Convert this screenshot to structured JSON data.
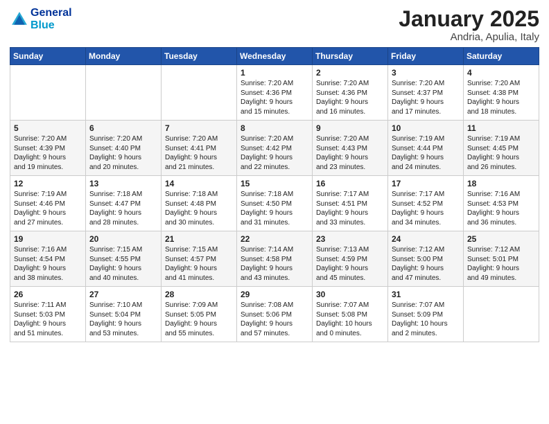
{
  "logo": {
    "line1": "General",
    "line2": "Blue"
  },
  "title": "January 2025",
  "subtitle": "Andria, Apulia, Italy",
  "weekdays": [
    "Sunday",
    "Monday",
    "Tuesday",
    "Wednesday",
    "Thursday",
    "Friday",
    "Saturday"
  ],
  "weeks": [
    [
      {
        "day": "",
        "info": ""
      },
      {
        "day": "",
        "info": ""
      },
      {
        "day": "",
        "info": ""
      },
      {
        "day": "1",
        "info": "Sunrise: 7:20 AM\nSunset: 4:36 PM\nDaylight: 9 hours\nand 15 minutes."
      },
      {
        "day": "2",
        "info": "Sunrise: 7:20 AM\nSunset: 4:36 PM\nDaylight: 9 hours\nand 16 minutes."
      },
      {
        "day": "3",
        "info": "Sunrise: 7:20 AM\nSunset: 4:37 PM\nDaylight: 9 hours\nand 17 minutes."
      },
      {
        "day": "4",
        "info": "Sunrise: 7:20 AM\nSunset: 4:38 PM\nDaylight: 9 hours\nand 18 minutes."
      }
    ],
    [
      {
        "day": "5",
        "info": "Sunrise: 7:20 AM\nSunset: 4:39 PM\nDaylight: 9 hours\nand 19 minutes."
      },
      {
        "day": "6",
        "info": "Sunrise: 7:20 AM\nSunset: 4:40 PM\nDaylight: 9 hours\nand 20 minutes."
      },
      {
        "day": "7",
        "info": "Sunrise: 7:20 AM\nSunset: 4:41 PM\nDaylight: 9 hours\nand 21 minutes."
      },
      {
        "day": "8",
        "info": "Sunrise: 7:20 AM\nSunset: 4:42 PM\nDaylight: 9 hours\nand 22 minutes."
      },
      {
        "day": "9",
        "info": "Sunrise: 7:20 AM\nSunset: 4:43 PM\nDaylight: 9 hours\nand 23 minutes."
      },
      {
        "day": "10",
        "info": "Sunrise: 7:19 AM\nSunset: 4:44 PM\nDaylight: 9 hours\nand 24 minutes."
      },
      {
        "day": "11",
        "info": "Sunrise: 7:19 AM\nSunset: 4:45 PM\nDaylight: 9 hours\nand 26 minutes."
      }
    ],
    [
      {
        "day": "12",
        "info": "Sunrise: 7:19 AM\nSunset: 4:46 PM\nDaylight: 9 hours\nand 27 minutes."
      },
      {
        "day": "13",
        "info": "Sunrise: 7:18 AM\nSunset: 4:47 PM\nDaylight: 9 hours\nand 28 minutes."
      },
      {
        "day": "14",
        "info": "Sunrise: 7:18 AM\nSunset: 4:48 PM\nDaylight: 9 hours\nand 30 minutes."
      },
      {
        "day": "15",
        "info": "Sunrise: 7:18 AM\nSunset: 4:50 PM\nDaylight: 9 hours\nand 31 minutes."
      },
      {
        "day": "16",
        "info": "Sunrise: 7:17 AM\nSunset: 4:51 PM\nDaylight: 9 hours\nand 33 minutes."
      },
      {
        "day": "17",
        "info": "Sunrise: 7:17 AM\nSunset: 4:52 PM\nDaylight: 9 hours\nand 34 minutes."
      },
      {
        "day": "18",
        "info": "Sunrise: 7:16 AM\nSunset: 4:53 PM\nDaylight: 9 hours\nand 36 minutes."
      }
    ],
    [
      {
        "day": "19",
        "info": "Sunrise: 7:16 AM\nSunset: 4:54 PM\nDaylight: 9 hours\nand 38 minutes."
      },
      {
        "day": "20",
        "info": "Sunrise: 7:15 AM\nSunset: 4:55 PM\nDaylight: 9 hours\nand 40 minutes."
      },
      {
        "day": "21",
        "info": "Sunrise: 7:15 AM\nSunset: 4:57 PM\nDaylight: 9 hours\nand 41 minutes."
      },
      {
        "day": "22",
        "info": "Sunrise: 7:14 AM\nSunset: 4:58 PM\nDaylight: 9 hours\nand 43 minutes."
      },
      {
        "day": "23",
        "info": "Sunrise: 7:13 AM\nSunset: 4:59 PM\nDaylight: 9 hours\nand 45 minutes."
      },
      {
        "day": "24",
        "info": "Sunrise: 7:12 AM\nSunset: 5:00 PM\nDaylight: 9 hours\nand 47 minutes."
      },
      {
        "day": "25",
        "info": "Sunrise: 7:12 AM\nSunset: 5:01 PM\nDaylight: 9 hours\nand 49 minutes."
      }
    ],
    [
      {
        "day": "26",
        "info": "Sunrise: 7:11 AM\nSunset: 5:03 PM\nDaylight: 9 hours\nand 51 minutes."
      },
      {
        "day": "27",
        "info": "Sunrise: 7:10 AM\nSunset: 5:04 PM\nDaylight: 9 hours\nand 53 minutes."
      },
      {
        "day": "28",
        "info": "Sunrise: 7:09 AM\nSunset: 5:05 PM\nDaylight: 9 hours\nand 55 minutes."
      },
      {
        "day": "29",
        "info": "Sunrise: 7:08 AM\nSunset: 5:06 PM\nDaylight: 9 hours\nand 57 minutes."
      },
      {
        "day": "30",
        "info": "Sunrise: 7:07 AM\nSunset: 5:08 PM\nDaylight: 10 hours\nand 0 minutes."
      },
      {
        "day": "31",
        "info": "Sunrise: 7:07 AM\nSunset: 5:09 PM\nDaylight: 10 hours\nand 2 minutes."
      },
      {
        "day": "",
        "info": ""
      }
    ]
  ]
}
